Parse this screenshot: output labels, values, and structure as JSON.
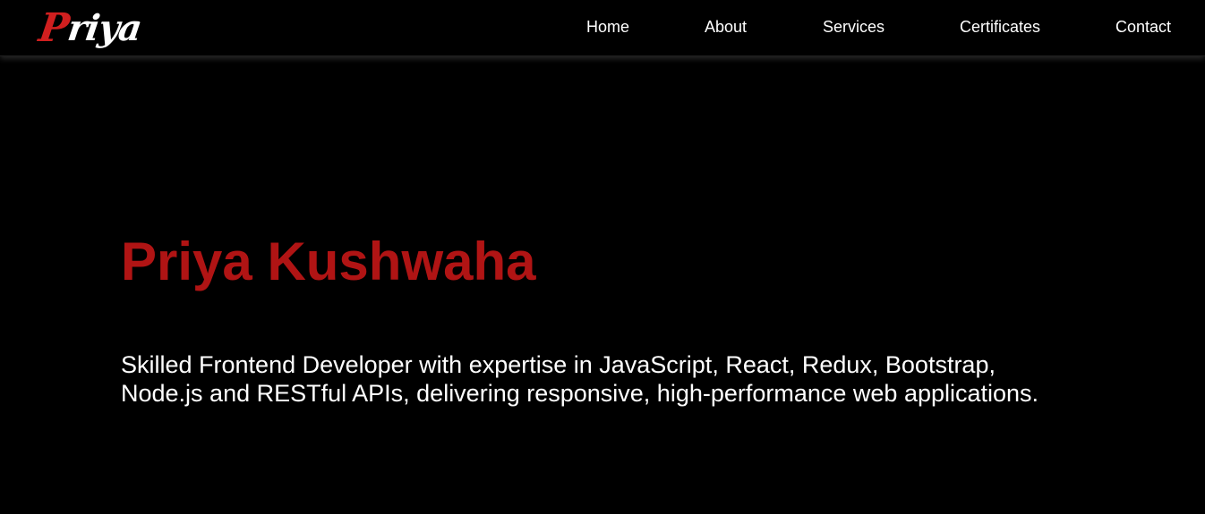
{
  "brand": {
    "first_letter": "P",
    "rest": "riya",
    "colors": {
      "accent": "#d01f1f",
      "text": "#ffffff"
    }
  },
  "nav": {
    "items": [
      {
        "label": "Home"
      },
      {
        "label": "About"
      },
      {
        "label": "Services"
      },
      {
        "label": "Certificates"
      },
      {
        "label": "Contact"
      }
    ]
  },
  "hero": {
    "name": "Priya Kushwaha",
    "description_line1": "Skilled Frontend Developer with expertise in JavaScript, React, Redux, Bootstrap,",
    "description_line2": "Node.js and RESTful APIs, delivering responsive, high-performance web applications."
  },
  "theme": {
    "background": "#000000",
    "name_color": "#b01414",
    "nav_text": "#ffffff"
  }
}
